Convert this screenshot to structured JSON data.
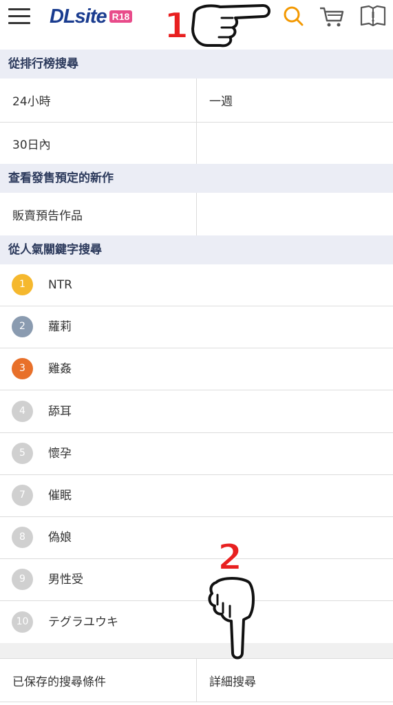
{
  "header": {
    "logo_text": "DLsite",
    "logo_badge": "R18",
    "icons": [
      "menu-icon",
      "search-icon",
      "cart-icon",
      "book-icon"
    ],
    "accent_color": "#f39800"
  },
  "sections": {
    "ranking": {
      "title": "從排行榜搜尋",
      "options": [
        "24小時",
        "一週",
        "30日內"
      ]
    },
    "upcoming": {
      "title": "查看發售預定的新作",
      "options": [
        "販賣預告作品"
      ]
    },
    "keywords": {
      "title": "從人氣關鍵字搜尋",
      "items": [
        {
          "rank": "1",
          "label": "NTR",
          "color": "#f5b82e"
        },
        {
          "rank": "2",
          "label": "蘿莉",
          "color": "#8a9bb0"
        },
        {
          "rank": "3",
          "label": "雞姦",
          "color": "#e8702a"
        },
        {
          "rank": "4",
          "label": "舔耳",
          "color": "#d0d0d0"
        },
        {
          "rank": "5",
          "label": "懷孕",
          "color": "#d0d0d0"
        },
        {
          "rank": "7",
          "label": "催眠",
          "color": "#d0d0d0"
        },
        {
          "rank": "8",
          "label": "偽娘",
          "color": "#d0d0d0"
        },
        {
          "rank": "9",
          "label": "男性受",
          "color": "#d0d0d0"
        },
        {
          "rank": "10",
          "label": "テグラユウキ",
          "color": "#d0d0d0"
        }
      ]
    }
  },
  "footer": {
    "saved_search": "已保存的搜尋條件",
    "advanced_search": "詳細搜尋"
  },
  "annotations": {
    "first": "1",
    "second": "2"
  }
}
